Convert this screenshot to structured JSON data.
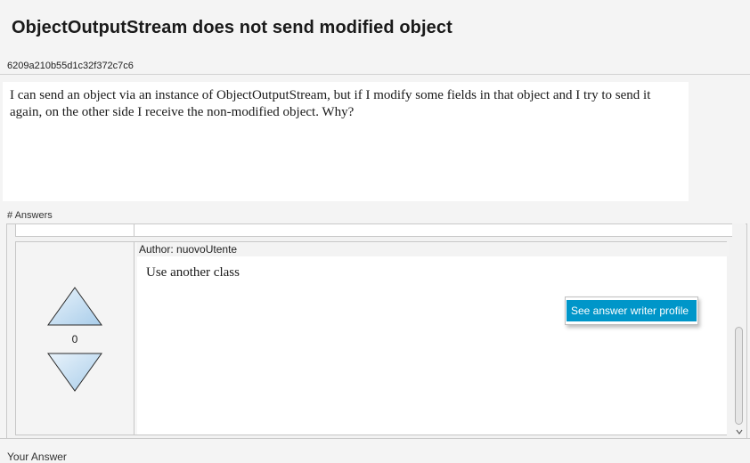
{
  "question": {
    "title": "ObjectOutputStream does not send modified object",
    "id": "6209a210b55d1c32f372c7c6",
    "body": "I can send an object via an instance of ObjectOutputStream, but if I modify some fields in that object and I try to send it again, on the other side I receive the non-modified object. Why?"
  },
  "answers_section": {
    "label": "# Answers",
    "items": [
      {
        "author_line": "Author: nuovoUtente",
        "text": "Use another class",
        "score": "0"
      }
    ]
  },
  "context_menu": {
    "items": [
      {
        "label": "See answer writer profile"
      }
    ]
  },
  "your_answer_label": "Your Answer",
  "colors": {
    "menu_highlight": "#0096c9",
    "vote_triangle_fill": "#c5dff3",
    "vote_triangle_stroke": "#2a2a2a"
  },
  "icons": {
    "upvote": "triangle-up-icon",
    "downvote": "triangle-down-icon",
    "scroll_down": "chevron-down-icon"
  }
}
